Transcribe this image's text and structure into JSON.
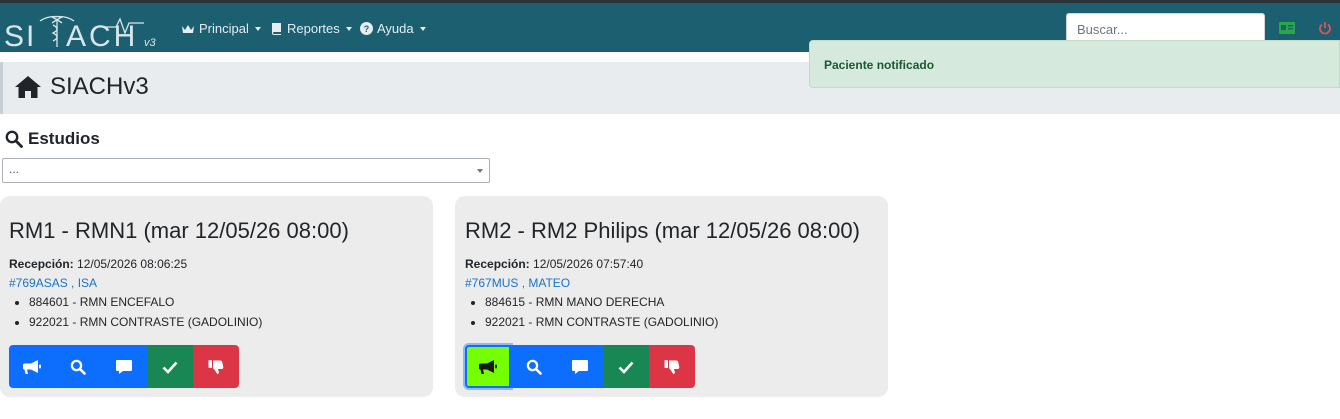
{
  "brand": {
    "logo_text": "SIACH",
    "logo_version": "v3"
  },
  "nav": {
    "items": [
      {
        "label": "Principal",
        "icon": "crown-icon"
      },
      {
        "label": "Reportes",
        "icon": "book-icon"
      },
      {
        "label": "Ayuda",
        "icon": "question-circle-icon"
      }
    ],
    "search_placeholder": "Buscar...",
    "right_icons": [
      "id-card-icon",
      "power-icon"
    ]
  },
  "toast": {
    "message": "Paciente notificado"
  },
  "page": {
    "title": "SIACHv3"
  },
  "studies": {
    "heading": "Estudios",
    "select_value": "..."
  },
  "cards": [
    {
      "title": "RM1 - RMN1 (mar 12/05/26 08:00)",
      "reception_label": "Recepción:",
      "reception_value": "12/05/2026 08:06:25",
      "patient": "#769ASAS , ISA",
      "studies": [
        "884601 - RMN ENCEFALO",
        "922021 - RMN CONTRASTE (GADOLINIO)"
      ]
    },
    {
      "title": "RM2 - RM2 Philips (mar 12/05/26 08:00)",
      "reception_label": "Recepción:",
      "reception_value": "12/05/2026 07:57:40",
      "patient": "#767MUS , MATEO",
      "studies": [
        "884615 - RMN MANO DERECHA",
        "922021 - RMN CONTRASTE (GADOLINIO)"
      ]
    }
  ],
  "colors": {
    "navbar": "#1c5f70",
    "primary": "#0d6efd",
    "success": "#198754",
    "danger": "#dc3545",
    "notified": "#76ff03",
    "toast_bg": "#d5eadc"
  }
}
